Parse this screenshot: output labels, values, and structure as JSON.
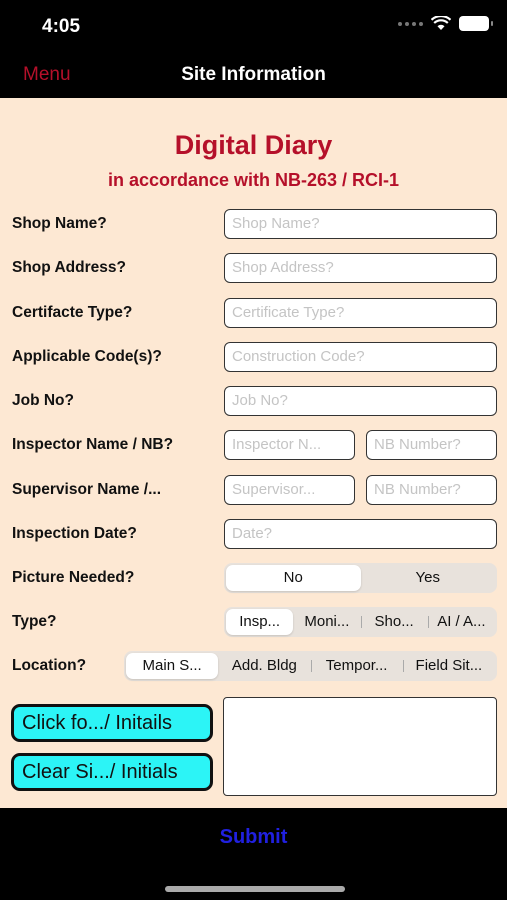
{
  "status_bar": {
    "time": "4:05"
  },
  "nav": {
    "menu_label": "Menu",
    "title": "Site Information"
  },
  "header": {
    "title": "Digital Diary",
    "subtitle": "in accordance with NB-263 / RCI-1"
  },
  "form": {
    "shop_name": {
      "label": "Shop Name?",
      "placeholder": "Shop Name?"
    },
    "shop_address": {
      "label": "Shop Address?",
      "placeholder": "Shop Address?"
    },
    "certificate_type": {
      "label": "Certifacte Type?",
      "placeholder": "Certificate Type?"
    },
    "applicable_codes": {
      "label": "Applicable Code(s)?",
      "placeholder": "Construction Code?"
    },
    "job_no": {
      "label": "Job No?",
      "placeholder": "Job No?"
    },
    "inspector": {
      "label": "Inspector Name / NB?",
      "name_placeholder": "Inspector N...",
      "nb_placeholder": "NB Number?"
    },
    "supervisor": {
      "label": "Supervisor Name /...",
      "name_placeholder": "Supervisor...",
      "nb_placeholder": "NB Number?"
    },
    "inspection_date": {
      "label": "Inspection Date?",
      "placeholder": "Date?"
    },
    "picture_needed": {
      "label": "Picture Needed?",
      "options": [
        "No",
        "Yes"
      ],
      "selected": "No"
    },
    "type": {
      "label": "Type?",
      "options": [
        "Insp...",
        "Moni...",
        "Sho...",
        "AI / A..."
      ],
      "selected": "Insp..."
    },
    "location": {
      "label": "Location?",
      "options": [
        "Main S...",
        "Add. Bldg",
        "Tempor...",
        "Field Sit..."
      ],
      "selected": "Main S..."
    }
  },
  "buttons": {
    "click_initials": "Click fo.../ Initails",
    "clear_initials": "Clear Si.../ Initials"
  },
  "bottom": {
    "submit_label": "Submit"
  },
  "colors": {
    "accent_red": "#b5102a",
    "background": "#fde8d3",
    "cyan_button": "#2cf4f6",
    "submit_blue": "#2020e0"
  }
}
